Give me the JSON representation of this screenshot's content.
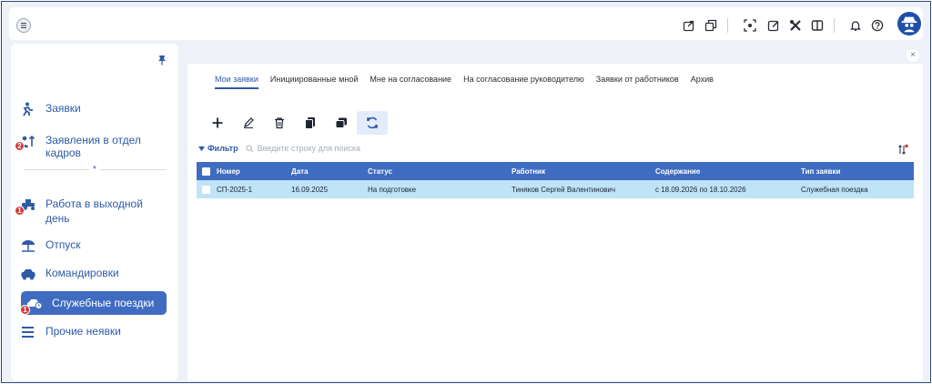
{
  "sidebar": {
    "items": [
      {
        "label": "Заявки",
        "icon": "person-run-icon"
      },
      {
        "label": "Заявления в отдел кадров",
        "icon": "person-arrow-icon",
        "badge": "2"
      },
      {
        "label": "Работа в выходной день",
        "icon": "tractor-icon",
        "badge": "1"
      },
      {
        "label": "Отпуск",
        "icon": "beach-umbrella-icon"
      },
      {
        "label": "Командировки",
        "icon": "car-icon"
      },
      {
        "label": "Служебные поездки",
        "icon": "car-clock-icon",
        "badge": "1"
      },
      {
        "label": "Прочие неявки",
        "icon": "list-icon"
      }
    ],
    "separator": "*"
  },
  "tabs": [
    {
      "label": "Мои заявки"
    },
    {
      "label": "Инициированные мной"
    },
    {
      "label": "Мне на согласование"
    },
    {
      "label": "На согласование руководителю"
    },
    {
      "label": "Заявки от работников"
    },
    {
      "label": "Архив"
    }
  ],
  "filter": {
    "label": "Фильтр",
    "search_placeholder": "Введите строку для поиска"
  },
  "table": {
    "columns": [
      "Номер",
      "Дата",
      "Статус",
      "Работник",
      "Содержание",
      "Тип заявки"
    ],
    "rows": [
      {
        "number": "СП-2025-1",
        "date": "16.09.2025",
        "status": "На подготовке",
        "employee": "Тиняков Сергей Валентинович",
        "content": "с 18.09.2026 по 18.10.2026",
        "type": "Служебная поездка"
      }
    ]
  },
  "close_symbol": "×",
  "colors": {
    "accent": "#3f6cc0",
    "link": "#2e5aa6",
    "row_selected": "#bfe3f7",
    "badge": "#d43a3a",
    "background": "#eef1f7"
  }
}
